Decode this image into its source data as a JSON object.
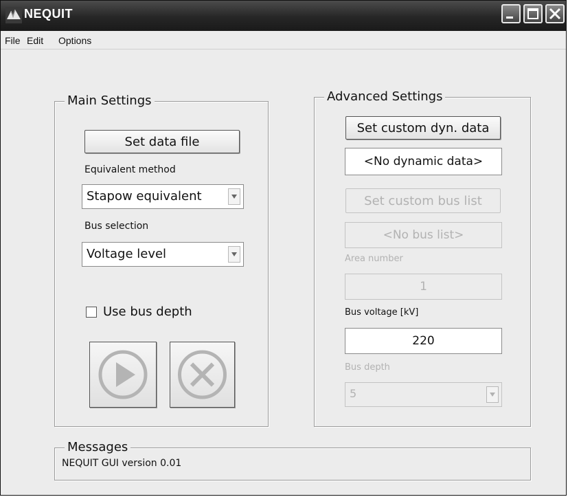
{
  "window": {
    "title": "NEQUIT"
  },
  "menu": {
    "items": [
      "File",
      "Edit",
      "Options"
    ]
  },
  "main_settings": {
    "title": "Main Settings",
    "set_data_file_label": "Set data file",
    "equivalent_method_label": "Equivalent method",
    "equivalent_method_value": "Stapow equivalent",
    "bus_selection_label": "Bus selection",
    "bus_selection_value": "Voltage level",
    "use_bus_depth_label": "Use bus depth",
    "use_bus_depth_checked": false,
    "run_icon": "play-icon",
    "cancel_icon": "cancel-icon"
  },
  "advanced_settings": {
    "title": "Advanced Settings",
    "set_custom_dyn_label": "Set custom dyn. data",
    "dynamic_data_value": "<No dynamic data>",
    "set_custom_bus_list_label": "Set custom bus list",
    "bus_list_value": "<No bus list>",
    "area_number_label": "Area number",
    "area_number_value": "1",
    "bus_voltage_label": "Bus voltage [kV]",
    "bus_voltage_value": "220",
    "bus_depth_label": "Bus depth",
    "bus_depth_value": "5"
  },
  "messages": {
    "title": "Messages",
    "text": "NEQUIT GUI version 0.01"
  },
  "colors": {
    "titlebar": "#262626",
    "window_bg": "#ececec",
    "disabled_text": "#b2b2b2"
  }
}
